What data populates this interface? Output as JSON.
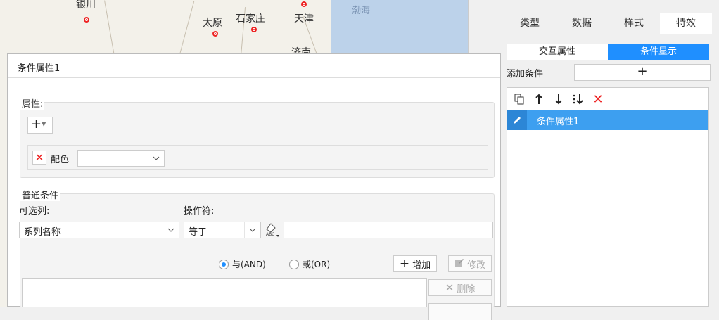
{
  "map": {
    "cities": [
      {
        "name": "银川"
      },
      {
        "name": "太原"
      },
      {
        "name": "石家庄"
      },
      {
        "name": "天津"
      },
      {
        "name": "济南"
      }
    ],
    "sea_label": "渤海",
    "colors": {
      "land": "#f3f1ea",
      "sea": "#bcd2ea",
      "marker": "#e22222"
    }
  },
  "right_panel": {
    "tabs": [
      {
        "label": "类型",
        "active": false
      },
      {
        "label": "数据",
        "active": false
      },
      {
        "label": "样式",
        "active": false
      },
      {
        "label": "特效",
        "active": true
      }
    ],
    "subtabs": [
      {
        "label": "交互属性",
        "active": false
      },
      {
        "label": "条件显示",
        "active": true
      }
    ],
    "add_condition_label": "添加条件",
    "add_condition_button": "+",
    "toolbar_icons": [
      "copy-icon",
      "arrow-up-icon",
      "arrow-down-icon",
      "move-bottom-icon",
      "delete-icon"
    ],
    "list_items": [
      {
        "label": "条件属性1",
        "selected": true
      }
    ],
    "accent_color": "#1f8fff"
  },
  "dialog": {
    "title": "条件属性1",
    "attributes": {
      "label": "属性:",
      "add_button": "+",
      "rows": [
        {
          "label": "配色",
          "value": ""
        }
      ]
    },
    "conditions": {
      "label": "普通条件",
      "column_label": "可选列:",
      "column_value": "系列名称",
      "operator_label": "操作符:",
      "operator_value": "等于",
      "operand_value": "",
      "radio_and": "与(AND)",
      "radio_or": "或(OR)",
      "radio_selected": "and",
      "add_button": "增加",
      "modify_button": "修改",
      "delete_button": "删除"
    }
  }
}
